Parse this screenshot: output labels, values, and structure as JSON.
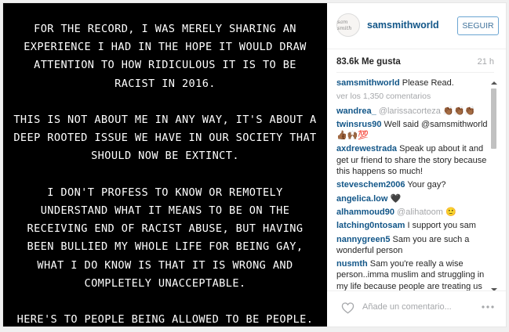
{
  "photo": {
    "paragraphs": [
      "FOR THE RECORD, I WAS MERELY SHARING AN EXPERIENCE I HAD IN THE HOPE IT WOULD DRAW ATTENTION TO HOW RIDICULOUS IT IS TO BE RACIST IN 2016.",
      "THIS IS NOT ABOUT ME IN ANY WAY, IT'S ABOUT A DEEP ROOTED ISSUE WE HAVE IN OUR SOCIETY THAT SHOULD NOW BE EXTINCT.",
      "I DON'T PROFESS TO KNOW OR REMOTELY UNDERSTAND WHAT IT MEANS TO BE ON THE RECEIVING END OF RACIST ABUSE, BUT HAVING BEEN BULLIED MY WHOLE LIFE FOR BEING GAY, WHAT I DO KNOW IS THAT IT IS WRONG AND COMPLETELY UNACCEPTABLE.",
      "HERE'S TO PEOPLE BEING ALLOWED TO BE PEOPLE."
    ]
  },
  "header": {
    "avatar_text": "sam smith",
    "username": "samsmithworld",
    "follow_label": "SEGUIR"
  },
  "meta": {
    "likes": "83.6k Me gusta",
    "time": "21 h"
  },
  "caption": {
    "user": "samsmithworld",
    "text": "Please Read."
  },
  "more_comments": "ver los 1,350 comentarios",
  "comments": [
    {
      "user": "wandrea_",
      "text": "@larissacorteza 👏🏾👏🏾👏🏾"
    },
    {
      "user": "twinsrus90",
      "text": "Well said @samsmithworld 👍🏾🙌🏾💯"
    },
    {
      "user": "axdrewestrada",
      "text": "Speak up about it and get ur friend to share the story because this happens so much!"
    },
    {
      "user": "steveschem2006",
      "text": "Your gay?"
    },
    {
      "user": "angelica.low",
      "text": "🖤"
    },
    {
      "user": "alhammoud90",
      "text": "@alihatoom 🙂"
    },
    {
      "user": "latching0ntosam",
      "text": "I support you sam"
    },
    {
      "user": "nannygreen5",
      "text": "Sam you are such a wonderful person"
    },
    {
      "user": "nusmth",
      "text": "Sam you're really a wise person..imma muslim and struggling in my life because people are treating us like a piece of shit because they think"
    }
  ],
  "footer": {
    "comment_placeholder": "Añade un comentario..."
  },
  "icons": {
    "heart": "heart-icon",
    "more": "more-options-icon",
    "scroll_up": "scroll-up-arrow-icon",
    "scroll_down": "scroll-down-arrow-icon"
  },
  "colors": {
    "username": "#125688",
    "muted": "#a5a7aa",
    "follow_border": "#6ba5d2",
    "photo_bg": "#000000"
  }
}
